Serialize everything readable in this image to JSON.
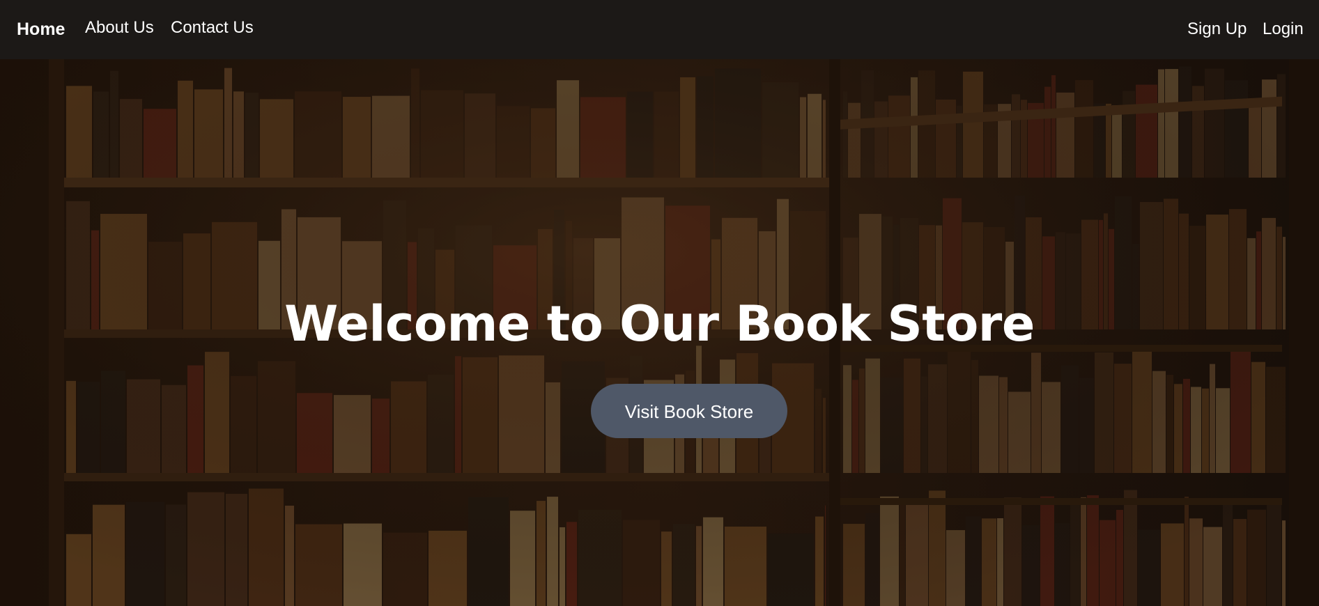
{
  "nav": {
    "brand": "Home",
    "links": [
      "About Us",
      "Contact Us"
    ],
    "auth": [
      "Sign Up",
      "Login"
    ]
  },
  "hero": {
    "title": "Welcome to Our Book Store",
    "button_label": "Visit Book Store"
  },
  "colors": {
    "navbar_bg": "#1c1917",
    "button_bg": "#4f5868",
    "text": "#ffffff"
  },
  "icons": [
    "bookshelf-background-image"
  ]
}
